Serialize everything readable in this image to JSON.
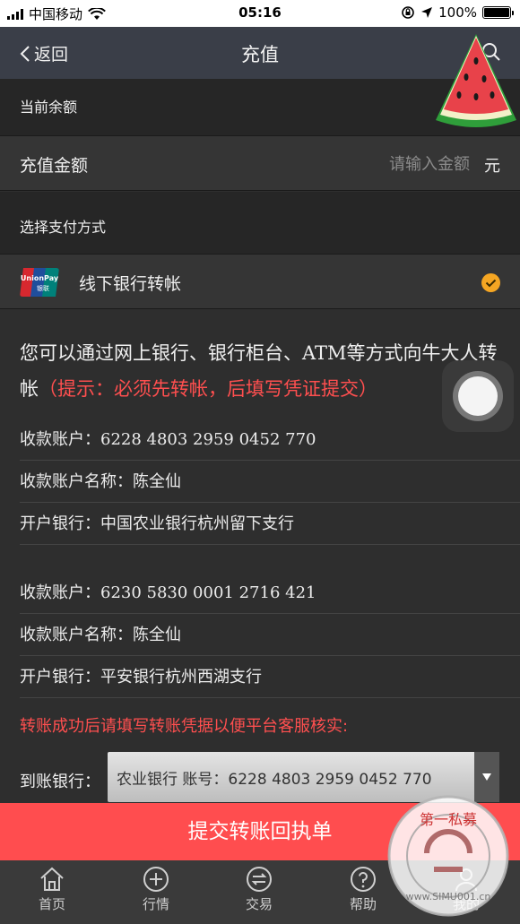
{
  "status_bar": {
    "carrier": "中国移动",
    "time": "05:16",
    "battery": "100%"
  },
  "nav": {
    "back_label": "返回",
    "title": "充值"
  },
  "balance_section": {
    "label": "当前余额"
  },
  "amount_row": {
    "label": "充值金额",
    "placeholder": "请输入金额",
    "unit": "元"
  },
  "payment_section": {
    "label": "选择支付方式"
  },
  "payment_method": {
    "label": "线下银行转帐",
    "logo_text_top": "UnionPay",
    "logo_text_bottom": "银联"
  },
  "transfer_info": {
    "intro": "您可以通过网上银行、银行柜台、ATM等方式向牛大人转帐",
    "hint": "（提示：必须先转帐，后填写凭证提交）",
    "accounts": [
      {
        "account_label": "收款账户：",
        "account_number": "6228 4803 2959 0452 770",
        "name_label": "收款账户名称：",
        "name": "陈全仙",
        "bank_label": "开户银行：",
        "bank": "中国农业银行杭州留下支行"
      },
      {
        "account_label": "收款账户：",
        "account_number": "6230 5830 0001 2716 421",
        "name_label": "收款账户名称：",
        "name": "陈全仙",
        "bank_label": "开户银行：",
        "bank": "平安银行杭州西湖支行"
      }
    ],
    "notice": "转账成功后请填写转账凭据以便平台客服核实:",
    "arrival_bank_label": "到账银行：",
    "arrival_bank_value": "农业银行 账号：6228 4803 2959 0452 770"
  },
  "submit_label": "提交转账回执单",
  "tabbar": [
    {
      "label": "首页",
      "icon": "home-icon"
    },
    {
      "label": "行情",
      "icon": "plus-circle-icon"
    },
    {
      "label": "交易",
      "icon": "exchange-icon"
    },
    {
      "label": "帮助",
      "icon": "help-icon"
    },
    {
      "label": "我的",
      "icon": "user-icon"
    }
  ],
  "watermark": {
    "stamp_text": "第一私募",
    "url_text": "www.SIMU001.cn"
  },
  "colors": {
    "accent_red": "#ff4d4f",
    "check_orange": "#f5a623",
    "nav_bg": "#3a3e48",
    "page_bg": "#2e2e2e"
  }
}
